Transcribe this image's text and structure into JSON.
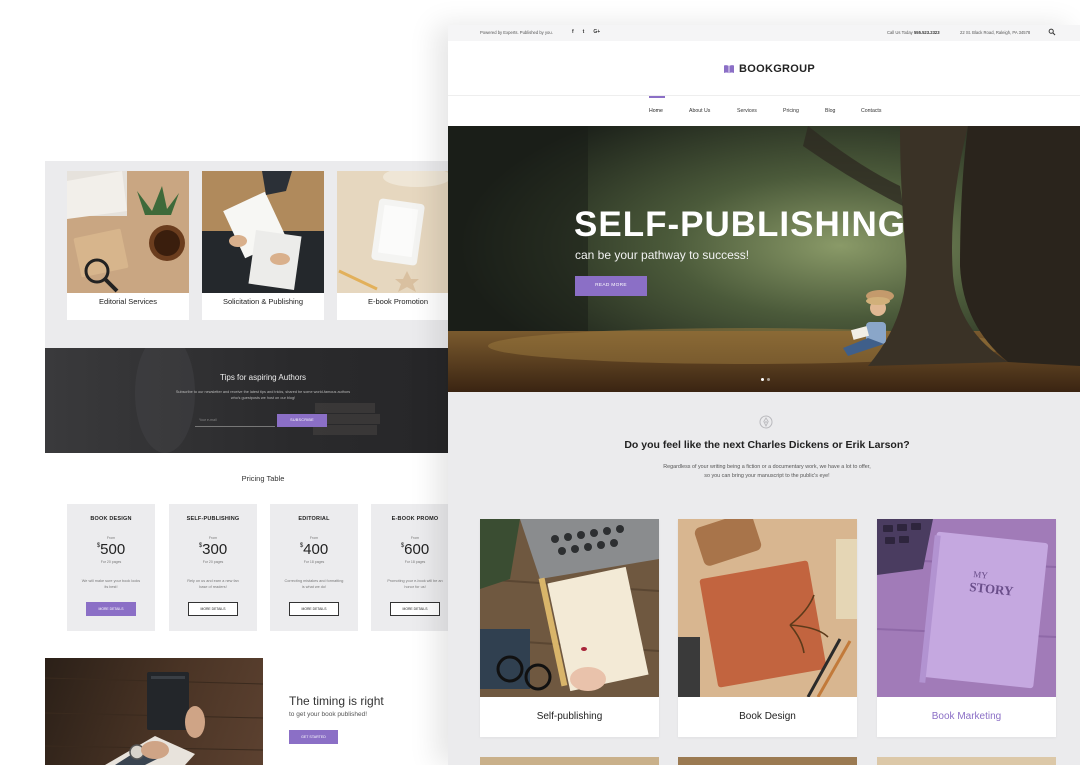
{
  "back": {
    "services": [
      {
        "label": "Editorial Services"
      },
      {
        "label": "Solicitation & Publishing"
      },
      {
        "label": "E-book Promotion"
      }
    ],
    "newsletter": {
      "title": "Tips for aspiring Authors",
      "desc": "Subscribe to our newsletter and receive the latest tips and tricks, shared be some world-famous authors who's guestposts we host on our blog!",
      "placeholder": "Your e-mail",
      "button": "SUBSCRIBE"
    },
    "pricing": {
      "title": "Pricing Table",
      "plans": [
        {
          "name": "BOOK DESIGN",
          "from": "From",
          "currency": "$",
          "price": "500",
          "pages": "For 20 pages",
          "desc": "We will make sure your book looks its best!",
          "button": "MORE DETAILS"
        },
        {
          "name": "SELF-PUBLISHING",
          "from": "From",
          "currency": "$",
          "price": "300",
          "pages": "For 20 pages",
          "desc": "Rely on us and earn a new fan base of readers!",
          "button": "MORE DETAILS"
        },
        {
          "name": "EDITORIAL",
          "from": "From",
          "currency": "$",
          "price": "400",
          "pages": "For 18 pages",
          "desc": "Correcting mistakes and formatting is what we do!",
          "button": "MORE DETAILS"
        },
        {
          "name": "E-BOOK PROMO",
          "from": "From",
          "currency": "$",
          "price": "600",
          "pages": "For 18 pages",
          "desc": "Promoting your e-book will be an honor for us!",
          "button": "MORE DETAILS"
        }
      ]
    },
    "timing": {
      "title": "The timing is right",
      "subtitle": "to get your book published!",
      "button": "GET STARTED"
    }
  },
  "front": {
    "topbar": {
      "left": "Powered by Experts. Published by you.",
      "social": [
        "f",
        "t",
        "G+"
      ],
      "call_label": "Call Us Today",
      "call_number": "555.523.2323",
      "address": "22 St. Black Road, Raleigh, PA 34578"
    },
    "logo": {
      "text": "BOOKGROUP"
    },
    "nav": [
      "Home",
      "About Us",
      "Services",
      "Pricing",
      "Blog",
      "Contacts"
    ],
    "hero": {
      "title": "SELF-PUBLISHING",
      "subtitle": "can be your pathway to success!",
      "button": "READ MORE"
    },
    "intro": {
      "title": "Do you feel like the next Charles Dickens or Erik Larson?",
      "line1": "Regardless of your writing being a fiction or a documentary work, we have a lot to offer,",
      "line2": "so you can bring your manuscript to the public's eye!"
    },
    "features": [
      {
        "label": "Self-publishing"
      },
      {
        "label": "Book Design"
      },
      {
        "label": "Book Marketing"
      }
    ],
    "book_cover_text": [
      "MY",
      "STORY"
    ]
  },
  "colors": {
    "accent": "#8b6fc6",
    "dark": "#222222",
    "panel": "#ebebed"
  }
}
